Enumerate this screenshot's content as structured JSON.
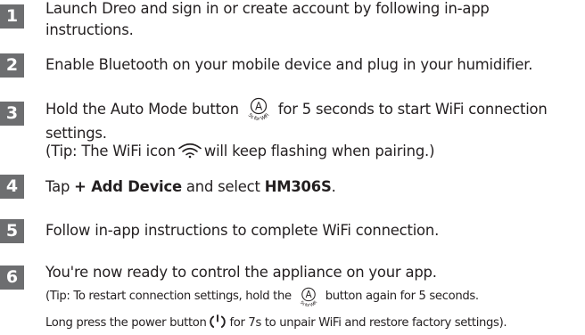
{
  "steps": [
    {
      "number": "1",
      "line1": "Launch Dreo and sign in or create account by following in-app",
      "line2": "instructions."
    },
    {
      "number": "2",
      "line1": "Enable Bluetooth on your mobile device and plug in your humidifier."
    },
    {
      "number": "3",
      "line1_before": "Hold the Auto Mode button",
      "line1_after": "for 5 seconds to start WiFi connection",
      "line2": "settings.",
      "tip_before": "(Tip: The WiFi icon",
      "tip_after": "will keep flashing when pairing.)"
    },
    {
      "number": "4",
      "before": "Tap ",
      "bold1": "+ Add Device",
      "middle": " and select ",
      "bold2": "HM306S",
      "after": "."
    },
    {
      "number": "5",
      "line1": "Follow in-app instructions to complete WiFi connection."
    },
    {
      "number": "6",
      "line1": "You're now ready to control the appliance on your app.",
      "tip1_before": "(Tip: To restart connection settings, hold the",
      "tip1_after": "button again for 5 seconds.",
      "tip2_before": "Long press the power button",
      "tip2_after": "for 7s to unpair WiFi and restore factory settings)."
    }
  ],
  "icons": {
    "auto_mode": {
      "letter": "A",
      "caption": "5s for WiFi"
    },
    "wifi": "wifi-icon",
    "power": "power-icon"
  },
  "colors": {
    "badge": "#6d6e70",
    "text": "#231f20"
  }
}
